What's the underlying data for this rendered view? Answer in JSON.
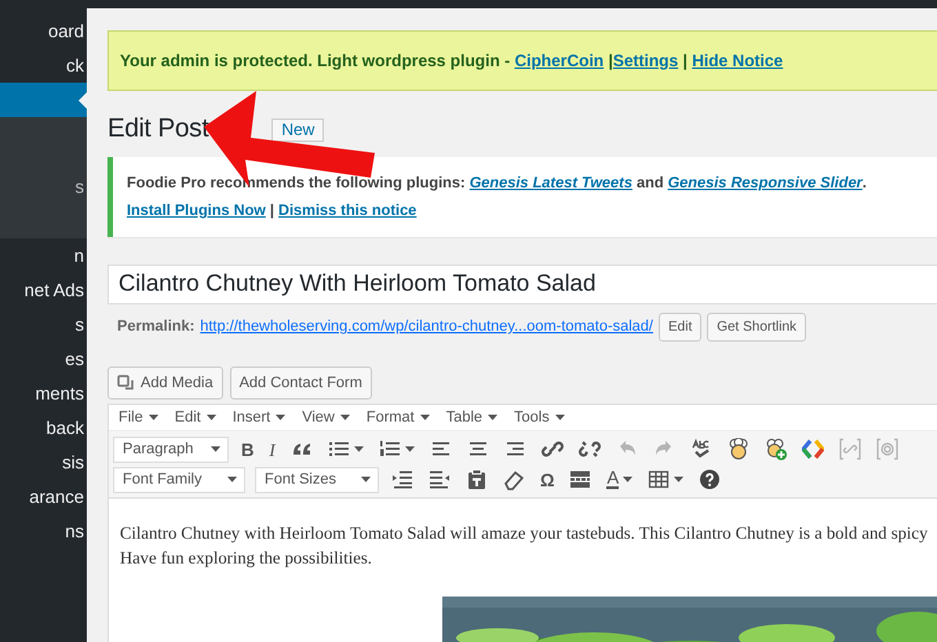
{
  "sidebar": {
    "items": [
      {
        "label": "oard",
        "selected": false
      },
      {
        "label": "ck",
        "selected": false
      },
      {
        "selected": true
      }
    ],
    "submenu": [
      {
        "label": "s"
      }
    ],
    "more_items": [
      {
        "label": "n"
      },
      {
        "label": "net Ads"
      },
      {
        "label": "s"
      },
      {
        "label": "es"
      },
      {
        "label": "ments"
      },
      {
        "label": "back"
      },
      {
        "label": "sis"
      },
      {
        "label": "arance"
      },
      {
        "label": "ns"
      }
    ]
  },
  "admin_notice": {
    "text": "Your admin is protected. Light wordpress plugin - ",
    "links": [
      {
        "text": "CipherCoin",
        "sep": " |"
      },
      {
        "text": "Settings",
        "sep": " | "
      },
      {
        "text": "Hide Notice"
      }
    ]
  },
  "heading": "Edit Post",
  "add_new_button": "New",
  "plugin_notice": {
    "text": "Foodie Pro recommends the following plugins: ",
    "plugins": [
      "Genesis Latest Tweets",
      "Genesis Responsive Slider"
    ],
    "joiner": " and ",
    "end": ".",
    "actions": [
      "Install Plugins Now",
      "Dismiss this notice"
    ],
    "action_sep": " | "
  },
  "title_field": {
    "value": "Cilantro Chutney With Heirloom Tomato Salad"
  },
  "permalink": {
    "label": "Permalink:",
    "url": "http://thewholeserving.com/wp/cilantro-chutney...oom-tomato-salad/",
    "buttons": [
      "Edit",
      "Get Shortlink"
    ]
  },
  "media_buttons": [
    {
      "label": "Add Media",
      "kind": "media"
    },
    {
      "label": "Add Contact Form",
      "kind": "plain"
    }
  ],
  "menubar": [
    "File",
    "Edit",
    "Insert",
    "View",
    "Format",
    "Table",
    "Tools"
  ],
  "toolbar_rows": [
    [
      {
        "kind": "select",
        "label": "Paragraph",
        "disabled": false
      },
      {
        "kind": "glyph",
        "text": "B",
        "disabled": false
      },
      {
        "kind": "glyph",
        "text": "I",
        "disabled": false
      },
      {
        "kind": "icon",
        "caret": false,
        "disabled": false
      },
      {
        "kind": "icon",
        "caret": true,
        "disabled": false
      },
      {
        "kind": "icon",
        "caret": true,
        "disabled": false
      },
      {
        "kind": "icon",
        "caret": false,
        "disabled": false
      },
      {
        "kind": "icon",
        "caret": false,
        "disabled": false
      },
      {
        "kind": "icon",
        "caret": false,
        "disabled": false
      },
      {
        "kind": "icon",
        "caret": false,
        "disabled": false
      },
      {
        "kind": "icon",
        "caret": false,
        "disabled": false
      },
      {
        "kind": "icon",
        "caret": false,
        "disabled": true
      },
      {
        "kind": "icon",
        "caret": false,
        "disabled": true
      },
      {
        "kind": "icon",
        "caret": false,
        "disabled": false
      },
      {
        "kind": "icon",
        "caret": false,
        "disabled": false
      },
      {
        "kind": "icon",
        "caret": false,
        "disabled": false
      },
      {
        "kind": "icon",
        "caret": false,
        "disabled": false
      },
      {
        "kind": "icon",
        "caret": false,
        "disabled": true
      },
      {
        "kind": "icon",
        "caret": false,
        "disabled": true
      }
    ],
    [
      {
        "kind": "select",
        "label": "Font Family",
        "disabled": false
      },
      {
        "kind": "select",
        "label": "Font Sizes",
        "disabled": false
      },
      {
        "kind": "icon",
        "caret": false,
        "disabled": false
      },
      {
        "kind": "icon",
        "caret": false,
        "disabled": false
      },
      {
        "kind": "icon",
        "caret": false,
        "disabled": false
      },
      {
        "kind": "icon",
        "caret": false,
        "disabled": false
      },
      {
        "kind": "glyph",
        "text": "Ω",
        "disabled": false
      },
      {
        "kind": "icon",
        "caret": false,
        "disabled": false
      },
      {
        "kind": "glyph",
        "text": "A",
        "caret": true,
        "underline": true,
        "disabled": false
      },
      {
        "kind": "icon",
        "caret": true,
        "disabled": false
      },
      {
        "kind": "icon",
        "caret": false,
        "disabled": false
      }
    ]
  ],
  "content": {
    "paragraph": "Cilantro Chutney with Heirloom Tomato Salad will amaze your tastebuds. This Cilantro Chutney is a bold and spicy",
    "paragraph_2": "Have fun exploring the possibilities."
  },
  "annotation": {
    "kind": "arrow",
    "color": "#ee1111"
  }
}
